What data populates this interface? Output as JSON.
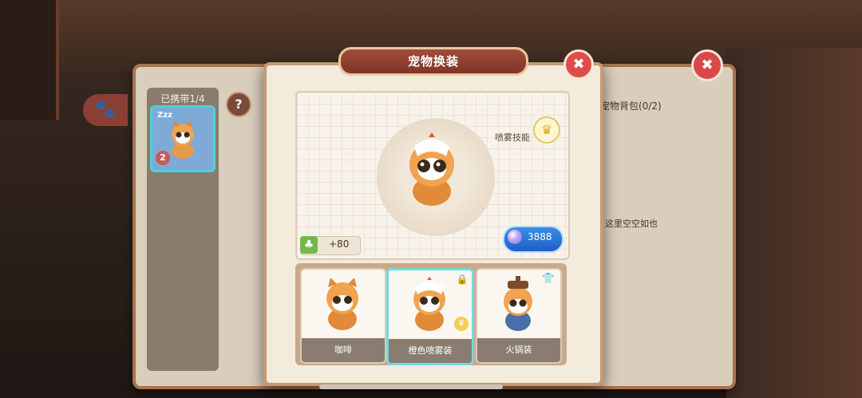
{
  "dialog": {
    "title": "宠物换装",
    "close_label": "✖"
  },
  "back_panel": {
    "carry_label": "已携带1/4",
    "carried_pet_level": "2",
    "zzz": "Zzz",
    "help_label": "?",
    "bag_title": "宠物背包(0/2)",
    "empty_text": "这里空空如也",
    "close_label": "✖"
  },
  "preview": {
    "skill_label": "喷雾技能",
    "clover_value": "+80",
    "coin_value": "3888"
  },
  "outfits": [
    {
      "label": "咖啡",
      "locked": false
    },
    {
      "label": "橙色喷雾装",
      "locked": true
    },
    {
      "label": "火锅装",
      "locked": false
    }
  ],
  "colors": {
    "accent": "#a24c3b",
    "selected_border": "#79d6e3",
    "coin_blue": "#3b8ee8"
  }
}
